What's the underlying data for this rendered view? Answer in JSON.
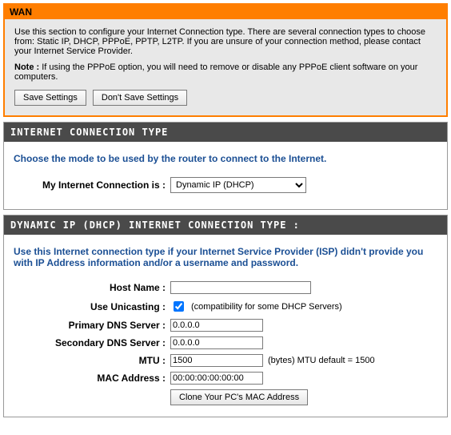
{
  "wan_panel": {
    "title": "WAN",
    "intro": "Use this section to configure your Internet Connection type. There are several connection types to choose from: Static IP, DHCP, PPPoE, PPTP, L2TP. If you are unsure of your connection method, please contact your Internet Service Provider.",
    "note_label": "Note :",
    "note_text": " If using the PPPoE option, you will need to remove or disable any PPPoE client software on your computers.",
    "save_btn": "Save Settings",
    "dont_save_btn": "Don't Save Settings"
  },
  "ict_section": {
    "title": "INTERNET CONNECTION TYPE",
    "instr": "Choose the mode to be used by the router to connect to the Internet.",
    "label": "My Internet Connection is :",
    "selected": "Dynamic IP (DHCP)"
  },
  "dhcp_section": {
    "title": "DYNAMIC IP (DHCP) INTERNET CONNECTION TYPE :",
    "instr": "Use this Internet connection type if your Internet Service Provider (ISP) didn't provide you with IP Address information and/or a username and password.",
    "host_name_label": "Host Name :",
    "host_name_value": "",
    "unicast_label": "Use Unicasting :",
    "unicast_checked": true,
    "unicast_hint": "(compatibility for some DHCP Servers)",
    "primary_dns_label": "Primary DNS Server :",
    "primary_dns_value": "0.0.0.0",
    "secondary_dns_label": "Secondary DNS Server :",
    "secondary_dns_value": "0.0.0.0",
    "mtu_label": "MTU :",
    "mtu_value": "1500",
    "mtu_hint": "(bytes) MTU default = 1500",
    "mac_label": "MAC Address :",
    "mac_value": "00:00:00:00:00:00",
    "clone_mac_btn": "Clone Your PC's MAC Address"
  }
}
